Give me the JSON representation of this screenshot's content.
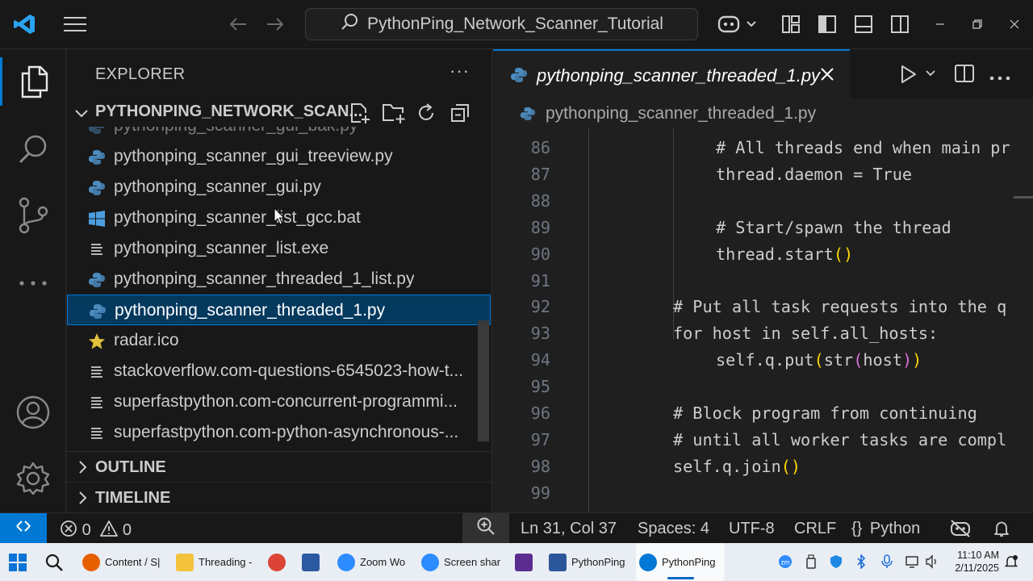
{
  "titlebar": {
    "search_text": "PythonPing_Network_Scanner_Tutorial",
    "icons": [
      "vscode-logo-icon",
      "menu-icon",
      "back-arrow-icon",
      "forward-arrow-icon",
      "copilot-icon",
      "layout-icon",
      "toggle-sidebar-icon",
      "toggle-panel-icon",
      "toggle-secondary-sidebar-icon",
      "minimize-icon",
      "restore-icon",
      "close-icon"
    ]
  },
  "activitybar": {
    "items": [
      "explorer-icon",
      "search-icon",
      "source-control-icon",
      "more-icon",
      "accounts-icon",
      "settings-gear-icon"
    ]
  },
  "sidebar": {
    "title": "EXPLORER",
    "more": "···",
    "folder_name": "PYTHONPING_NETWORK_SCAN...",
    "files": [
      {
        "name": "pythonping_scanner_gui_bak.py",
        "type": "python"
      },
      {
        "name": "pythonping_scanner_gui_treeview.py",
        "type": "python"
      },
      {
        "name": "pythonping_scanner_gui.py",
        "type": "python"
      },
      {
        "name": "pythonping_scanner_list_gcc.bat",
        "type": "windows"
      },
      {
        "name": "pythonping_scanner_list.exe",
        "type": "text"
      },
      {
        "name": "pythonping_scanner_threaded_1_list.py",
        "type": "python"
      },
      {
        "name": "pythonping_scanner_threaded_1.py",
        "type": "python",
        "selected": true
      },
      {
        "name": "radar.ico",
        "type": "star"
      },
      {
        "name": "stackoverflow.com-questions-6545023-how-t...",
        "type": "text"
      },
      {
        "name": "superfastpython.com-concurrent-programmi...",
        "type": "text"
      },
      {
        "name": "superfastpython.com-python-asynchronous-...",
        "type": "text"
      }
    ],
    "sections": [
      "OUTLINE",
      "TIMELINE"
    ]
  },
  "editor": {
    "tab_label": "pythonping_scanner_threaded_1.py",
    "breadcrumb": "pythonping_scanner_threaded_1.py",
    "lines": [
      {
        "num": "86",
        "indent": 2,
        "text": "# All threads end when main pr"
      },
      {
        "num": "87",
        "indent": 2,
        "text": "thread.daemon = True"
      },
      {
        "num": "88",
        "indent": 0,
        "text": ""
      },
      {
        "num": "89",
        "indent": 2,
        "text": "# Start/spawn the thread"
      },
      {
        "num": "90",
        "indent": 2,
        "text": "thread.start()"
      },
      {
        "num": "91",
        "indent": 0,
        "text": ""
      },
      {
        "num": "92",
        "indent": 1,
        "text": "# Put all task requests into the q"
      },
      {
        "num": "93",
        "indent": 1,
        "text": "for host in self.all_hosts:"
      },
      {
        "num": "94",
        "indent": 2,
        "text": "self.q.put(str(host))"
      },
      {
        "num": "95",
        "indent": 0,
        "text": ""
      },
      {
        "num": "96",
        "indent": 1,
        "text": "# Block program from continuing"
      },
      {
        "num": "97",
        "indent": 1,
        "text": "# until all worker tasks are compl"
      },
      {
        "num": "98",
        "indent": 1,
        "text": "self.q.join()"
      },
      {
        "num": "99",
        "indent": 0,
        "text": ""
      }
    ]
  },
  "statusbar": {
    "errors": "0",
    "warnings": "0",
    "position": "Ln 31, Col 37",
    "spaces": "Spaces: 4",
    "encoding": "UTF-8",
    "eol": "CRLF",
    "language_braces": "{}",
    "language": "Python"
  },
  "taskbar": {
    "apps": [
      {
        "label": "Content / S|",
        "icon": "firefox-icon",
        "color": "#e66000"
      },
      {
        "label": "Threading -",
        "icon": "folder-icon",
        "color": "#f3c33c"
      },
      {
        "label": "",
        "icon": "chrome-icon",
        "color": "#db4437"
      },
      {
        "label": "",
        "icon": "network-app-icon",
        "color": "#2c5aa0"
      },
      {
        "label": "Zoom Wo",
        "icon": "zoom-icon",
        "color": "#2d8cff"
      },
      {
        "label": "Screen shar",
        "icon": "zoom-screen-share-icon",
        "color": "#2d8cff"
      },
      {
        "label": "",
        "icon": "visual-studio-icon",
        "color": "#5c2d91"
      },
      {
        "label": "PythonPing",
        "icon": "word-icon",
        "color": "#2b579a"
      },
      {
        "label": "PythonPing",
        "icon": "vscode-icon",
        "color": "#0078d4",
        "active": true
      }
    ],
    "time": "11:10 AM",
    "date": "2/11/2025"
  }
}
